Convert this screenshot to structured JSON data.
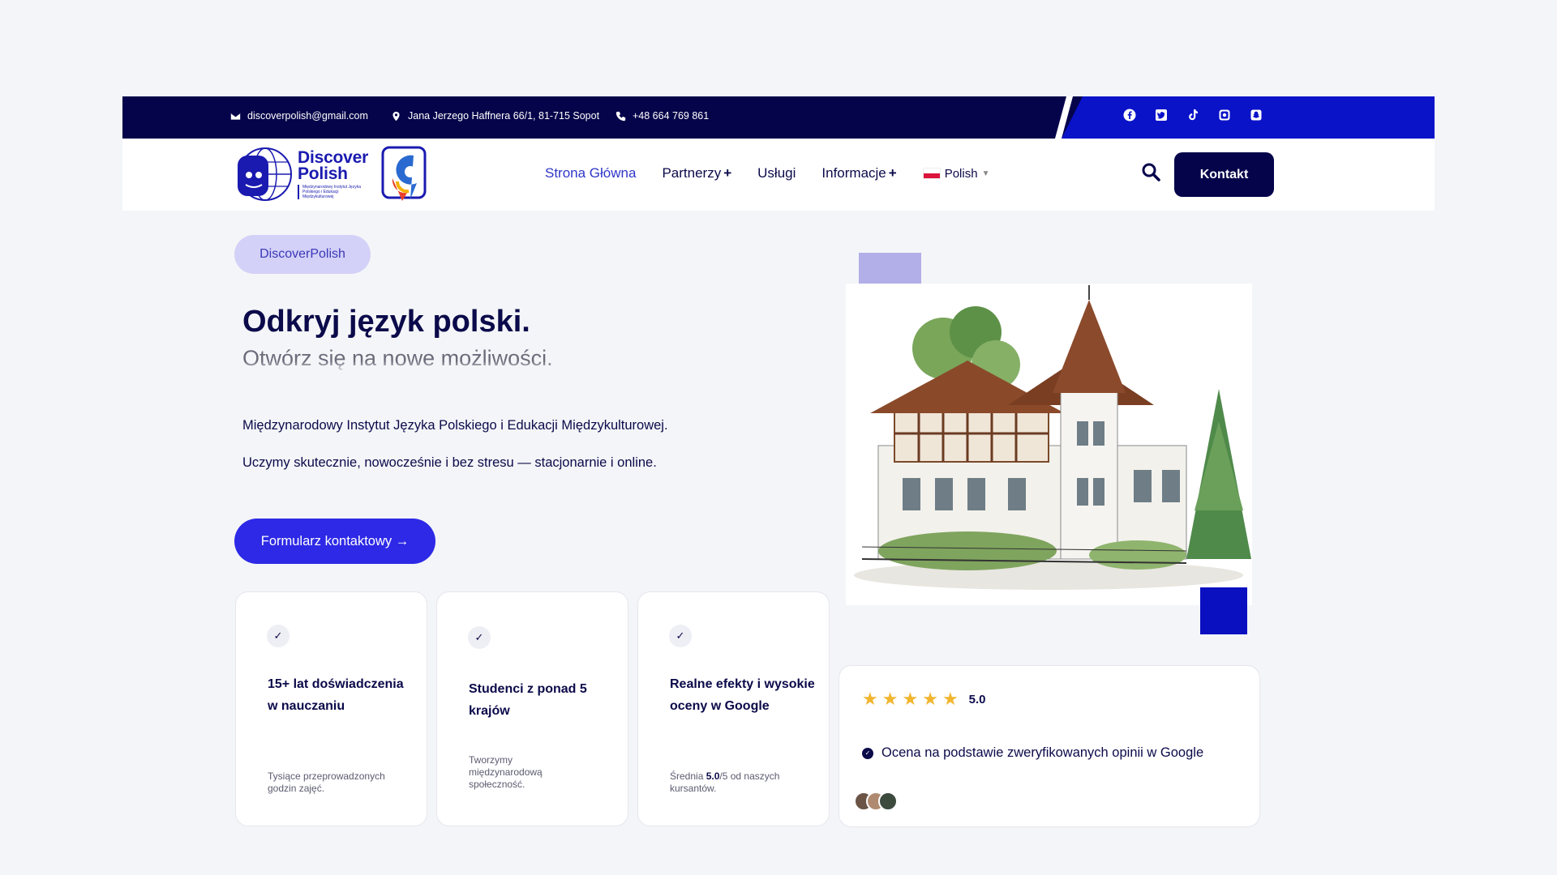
{
  "topbar": {
    "email": "discoverpolish@gmail.com",
    "address": "Jana Jerzego Haffnera 66/1, 81-715 Sopot",
    "phone": "+48 664 769 861",
    "social_icons": [
      "facebook-icon",
      "twitter-icon",
      "tiktok-icon",
      "instagram-icon",
      "snapchat-icon"
    ]
  },
  "logo": {
    "title_line1": "Discover",
    "title_line2": "Polish",
    "subtitle": "Międzynarodowy Instytut Języka Polskiego i Edukacji Międzykulturowej"
  },
  "nav": {
    "items": [
      {
        "label": "Strona Główna",
        "active": true
      },
      {
        "label": "Partnerzy",
        "has_plus": true
      },
      {
        "label": "Usługi"
      },
      {
        "label": "Informacje",
        "has_plus": true
      }
    ],
    "language": "Polish",
    "contact_button": "Kontakt"
  },
  "hero": {
    "pill": "DiscoverPolish",
    "title": "Odkryj język polski.",
    "subtitle": "Otwórz się na nowe możliwości.",
    "paragraph1": "Międzynarodowy Instytut Języka Polskiego i Edukacji Międzykulturowej.",
    "paragraph2": "Uczymy skutecznie, nowocześnie i bez stresu — stacjonarnie i online.",
    "cta": "Formularz kontaktowy →"
  },
  "features": [
    {
      "title": "15+ lat doświadczenia w nauczaniu",
      "desc": "Tysiące przeprowadzonych godzin zajęć."
    },
    {
      "title": "Studenci z ponad 5 krajów",
      "desc": "Tworzymy międzynarodową społeczność."
    },
    {
      "title": "Realne efekty i wysokie oceny w Google",
      "desc_prefix": "Średnia ",
      "desc_bold": "5.0",
      "desc_suffix": "/5 od naszych kursantów."
    }
  ],
  "review": {
    "stars": 5,
    "rating": "5.0",
    "note": "Ocena na podstawie zweryfikowanych opinii w Google"
  },
  "colors": {
    "navy": "#05034a",
    "brand_blue": "#0a13c8",
    "cta_blue": "#2d29e6",
    "star": "#f1b52e"
  }
}
